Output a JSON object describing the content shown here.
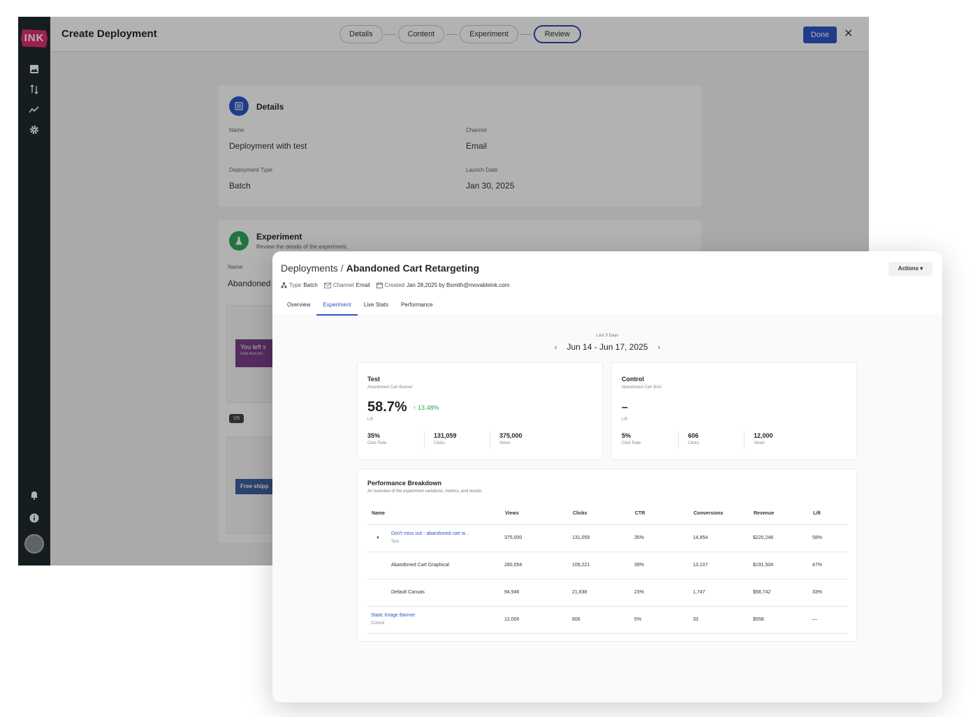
{
  "back": {
    "logo": "INK",
    "title": "Create Deployment",
    "steps": [
      "Details",
      "Content",
      "Experiment",
      "Review"
    ],
    "done_label": "Done",
    "close_glyph": "✕",
    "details": {
      "heading": "Details",
      "fields": {
        "name_label": "Name",
        "name_value": "Deployment with test",
        "channel_label": "Channel",
        "channel_value": "Email",
        "type_label": "Deployment Type",
        "type_value": "Batch",
        "launch_label": "Launch Date",
        "launch_value": "Jan 30, 2025"
      }
    },
    "experiment": {
      "heading": "Experiment",
      "subtitle": "Review the details of the experiment.",
      "name_label": "Name",
      "name_value": "Abandoned",
      "banner_a": "You left s",
      "banner_a_small": "Grab them bef",
      "vs": "VS",
      "banner_b": "Free shipp"
    },
    "rail_icons": [
      "image-icon",
      "sort-icon",
      "trend-icon",
      "gear-icon",
      "bell-icon",
      "info-icon",
      "avatar"
    ]
  },
  "front": {
    "breadcrumb_root": "Deployments",
    "breadcrumb_sep": "/",
    "breadcrumb_current": "Abandoned Cart Retargeting",
    "actions_label": "Actions",
    "meta": {
      "type_label": "Type",
      "type_value": "Batch",
      "channel_label": "Channel",
      "channel_value": "Email",
      "created_label": "Created",
      "created_value": "Jan 28,2025 by Bsmith@movableink.com"
    },
    "tabs": [
      "Overview",
      "Experiment",
      "Live Stats",
      "Performance"
    ],
    "active_tab": "Experiment",
    "period_label": "Last 3 Days",
    "date_range": "Jun 14  - Jun 17, 2025",
    "test": {
      "name": "Test",
      "subtitle": "Abandoned Cart Banner",
      "lift": "58.7%",
      "delta": "↑ 13.48%",
      "lift_label": "Lift",
      "click_rate": "35%",
      "click_rate_label": "Click Rate",
      "clicks": "131,059",
      "clicks_label": "Clicks",
      "views": "375,000",
      "views_label": "Views"
    },
    "control": {
      "name": "Control",
      "subtitle": "Abandoned Cart BAU",
      "lift": "–",
      "lift_label": "Lift",
      "click_rate": "5%",
      "click_rate_label": "Click Rate",
      "clicks": "606",
      "clicks_label": "Clicks",
      "views": "12,000",
      "views_label": "Views"
    },
    "breakdown": {
      "title": "Performance Breakdown",
      "subtitle": "An overview of the experiment variations, metrics, and results.",
      "columns": [
        "Name",
        "Views",
        "Clicks",
        "CTR",
        "Conversions",
        "Revenue",
        "Lift"
      ],
      "rows": [
        {
          "name": "Don't miss out - abandoned cart w...",
          "tag": "Test",
          "views": "375,000",
          "clicks": "131,059",
          "ctr": "35%",
          "conversions": "14,854",
          "revenue": "$220,246",
          "lift": "58%"
        },
        {
          "name": "Abandoned Cart Graphical",
          "tag": "",
          "views": "280,054",
          "clicks": "109,221",
          "ctr": "39%",
          "conversions": "13,107",
          "revenue": "$191,504",
          "lift": "47%"
        },
        {
          "name": "Default Canvas",
          "tag": "",
          "views": "94,946",
          "clicks": "21,838",
          "ctr": "23%",
          "conversions": "1,747",
          "revenue": "$58,742",
          "lift": "33%"
        },
        {
          "name": "Static Image Banner",
          "tag": "Control",
          "views": "12,000",
          "clicks": "606",
          "ctr": "5%",
          "conversions": "33",
          "revenue": "$558",
          "lift": "—"
        }
      ]
    }
  },
  "colors": {
    "accent": "#2f55c8",
    "rail": "#1f2a2e",
    "positive": "#2ea65a",
    "details_icon": "#2f55c8",
    "experiment_icon": "#2ea65a"
  }
}
